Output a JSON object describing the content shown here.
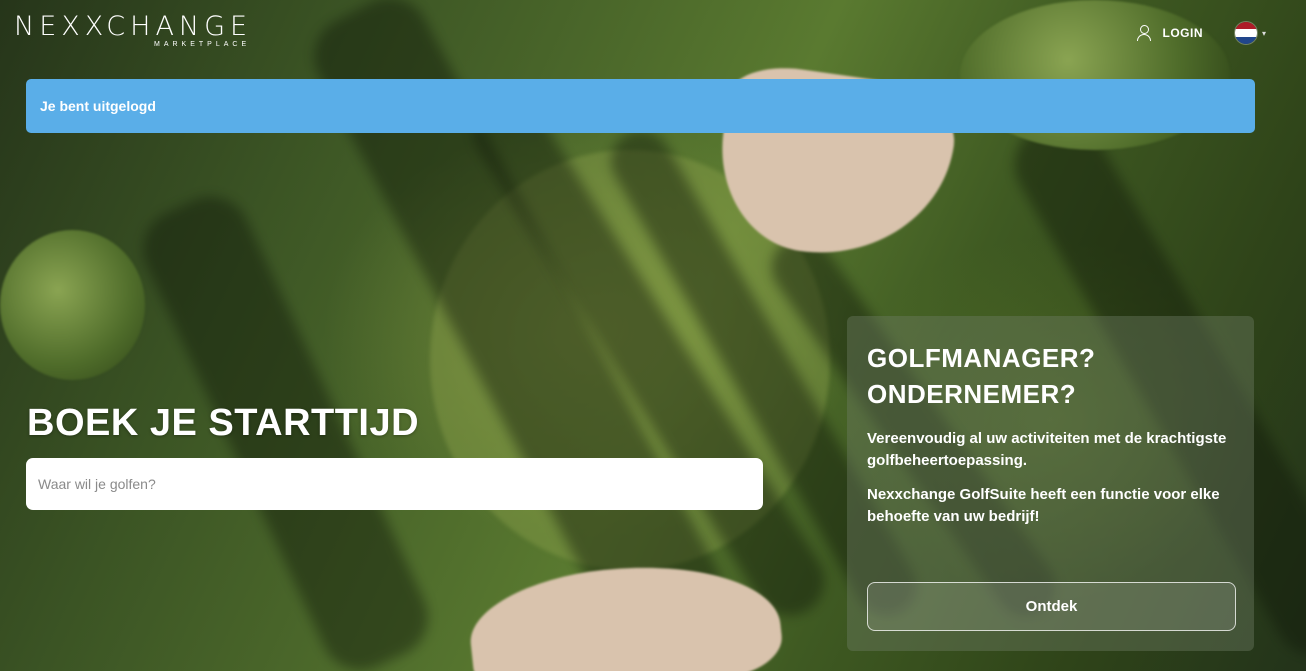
{
  "brand": {
    "logo_text": "NEXXCHANGE",
    "logo_subtext": "MARKETPLACE"
  },
  "nav": {
    "login_label": "LOGIN",
    "user_icon": "user-icon",
    "language_flag": "netherlands-flag-icon",
    "flag_colors": [
      "#ae1c28",
      "#ffffff",
      "#21468b"
    ]
  },
  "alert": {
    "message": "Je bent uitgelogd",
    "color": "#5aaee8"
  },
  "hero": {
    "title": "BOEK JE STARTTIJD",
    "search_placeholder": "Waar wil je golfen?"
  },
  "promo": {
    "title_line1": "GOLFMANAGER?",
    "title_line2": "ONDERNEMER?",
    "text1": "Vereenvoudig al uw activiteiten met de krachtigste golfbeheertoepassing.",
    "text2": "Nexxchange GolfSuite heeft een functie voor elke behoefte van uw bedrijf!",
    "button_label": "Ontdek"
  }
}
